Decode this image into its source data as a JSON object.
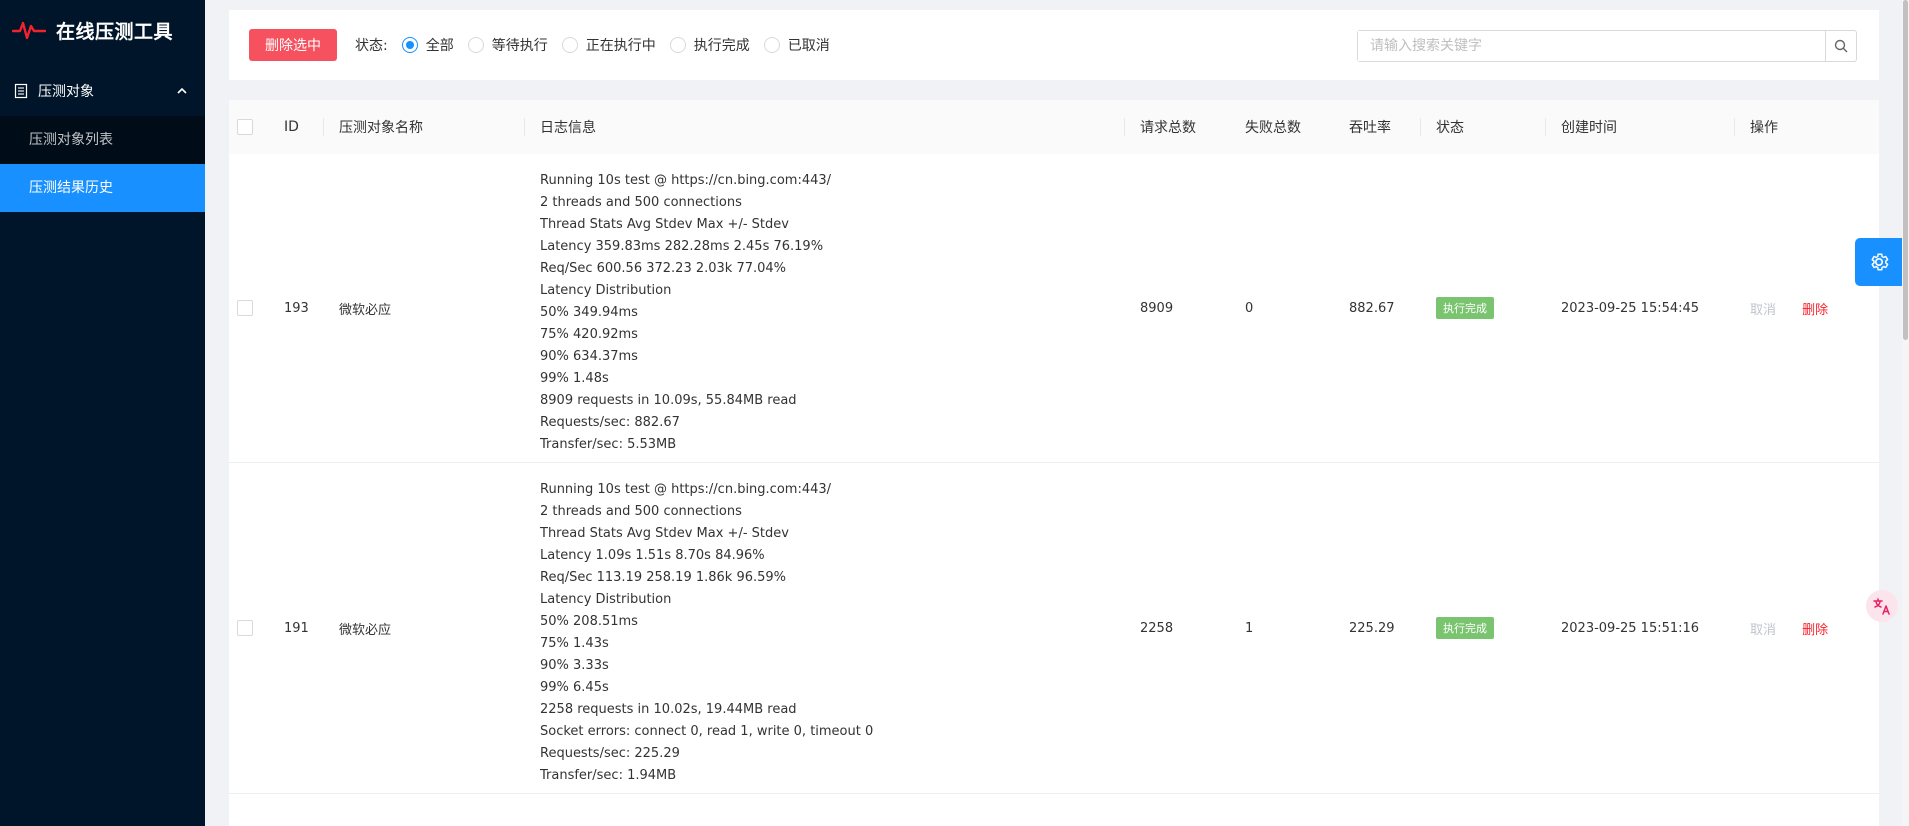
{
  "app": {
    "title": "在线压测工具"
  },
  "sidebar": {
    "group_label": "压测对象",
    "items": [
      {
        "label": "压测对象列表"
      },
      {
        "label": "压测结果历史"
      }
    ]
  },
  "toolbar": {
    "delete_label": "删除选中",
    "status_label": "状态:",
    "filters": [
      "全部",
      "等待执行",
      "正在执行中",
      "执行完成",
      "已取消"
    ],
    "selected_filter": "全部",
    "search_placeholder": "请输入搜索关键字"
  },
  "table": {
    "headers": {
      "id": "ID",
      "name": "压测对象名称",
      "log": "日志信息",
      "total": "请求总数",
      "fail": "失败总数",
      "rate": "吞吐率",
      "status": "状态",
      "created": "创建时间",
      "actions": "操作"
    },
    "rows": [
      {
        "id": "193",
        "name": "微软必应",
        "log": [
          "Running 10s test @ https://cn.bing.com:443/",
          "2 threads and 500 connections",
          "Thread Stats Avg Stdev Max +/- Stdev",
          "Latency 359.83ms 282.28ms 2.45s 76.19%",
          "Req/Sec 600.56 372.23 2.03k 77.04%",
          "Latency Distribution",
          "50% 349.94ms",
          "75% 420.92ms",
          "90% 634.37ms",
          "99% 1.48s",
          "8909 requests in 10.09s, 55.84MB read",
          "Requests/sec: 882.67",
          "Transfer/sec: 5.53MB"
        ],
        "total": "8909",
        "fail": "0",
        "rate": "882.67",
        "status": "执行完成",
        "created": "2023-09-25 15:54:45",
        "cancel": "取消",
        "delete": "删除"
      },
      {
        "id": "191",
        "name": "微软必应",
        "log": [
          "Running 10s test @ https://cn.bing.com:443/",
          "2 threads and 500 connections",
          "Thread Stats Avg Stdev Max +/- Stdev",
          "Latency 1.09s 1.51s 8.70s 84.96%",
          "Req/Sec 113.19 258.19 1.86k 96.59%",
          "Latency Distribution",
          "50% 208.51ms",
          "75% 1.43s",
          "90% 3.33s",
          "99% 6.45s",
          "2258 requests in 10.02s, 19.44MB read",
          "Socket errors: connect 0, read 1, write 0, timeout 0",
          "Requests/sec: 225.29",
          "Transfer/sec: 1.94MB"
        ],
        "total": "2258",
        "fail": "1",
        "rate": "225.29",
        "status": "执行完成",
        "created": "2023-09-25 15:51:16",
        "cancel": "取消",
        "delete": "删除"
      }
    ]
  },
  "colors": {
    "sidebar_bg": "#001529",
    "accent": "#1890ff",
    "danger": "#f5515f",
    "success_badge": "#7ac470",
    "logo": "#f5222d"
  },
  "icons": {
    "logo": "heartbeat-icon",
    "group": "document-icon",
    "caret": "chevron-up-icon",
    "search": "search-icon",
    "settings": "gear-icon",
    "translate": "translate-icon"
  }
}
